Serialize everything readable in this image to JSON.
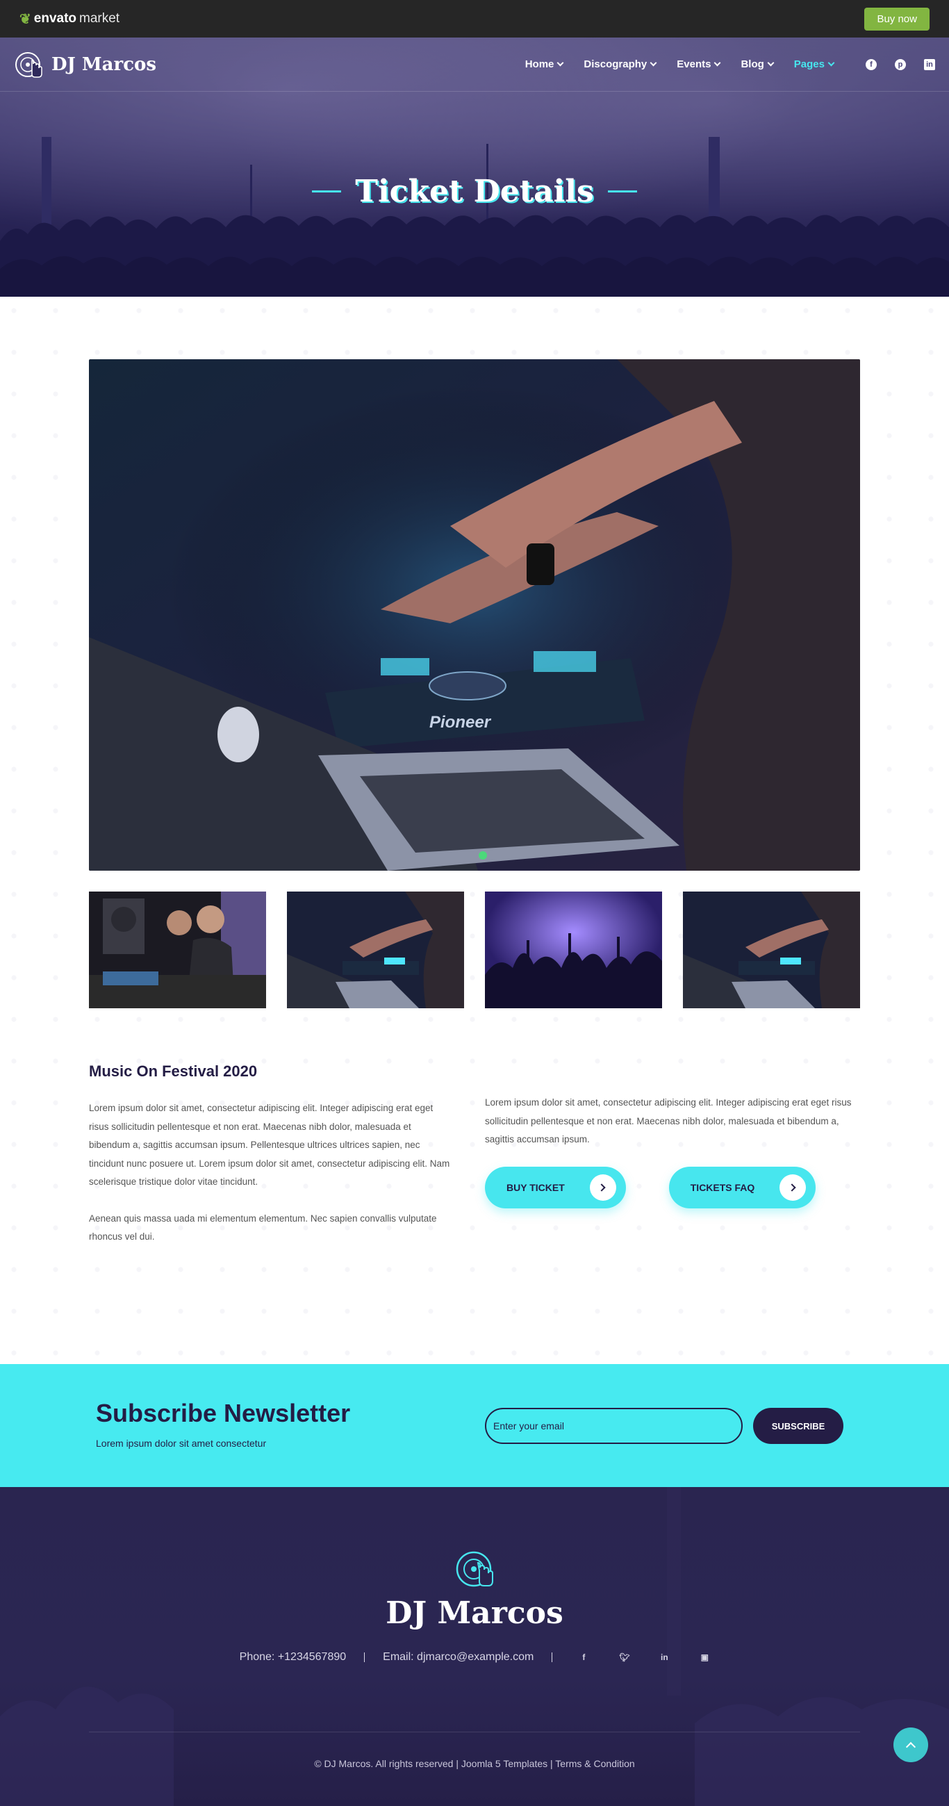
{
  "envato": {
    "logo_word": "envato",
    "logo_suffix": "market",
    "buy_label": "Buy now"
  },
  "header": {
    "brand": "DJ Marcos",
    "nav": [
      {
        "label": "Home"
      },
      {
        "label": "Discography"
      },
      {
        "label": "Events"
      },
      {
        "label": "Blog"
      },
      {
        "label": "Pages"
      }
    ],
    "social_icons": [
      "facebook-icon",
      "pinterest-icon",
      "linkedin-icon"
    ]
  },
  "hero": {
    "title": "Ticket Details"
  },
  "event": {
    "title": "Music On Festival 2020",
    "paragraph_1": "Lorem ipsum dolor sit amet, consectetur adipiscing elit. Integer adipiscing erat eget risus sollicitudin pellentesque et non erat. Maecenas nibh dolor, malesuada et bibendum a, sagittis accumsan ipsum. Pellentesque ultrices ultrices sapien, nec tincidunt nunc posuere ut. Lorem ipsum dolor sit amet, consectetur adipiscing elit. Nam scelerisque tristique dolor vitae tincidunt.",
    "paragraph_2": "Aenean quis massa uada mi elementum elementum. Nec sapien convallis vulputate rhoncus vel dui.",
    "paragraph_right": "Lorem ipsum dolor sit amet, consectetur adipiscing elit. Integer adipiscing erat eget risus sollicitudin pellentesque et non erat. Maecenas nibh dolor, malesuada et bibendum a, sagittis accumsan ipsum.",
    "buy_ticket_label": "BUY TICKET",
    "tickets_faq_label": "TICKETS FAQ"
  },
  "newsletter": {
    "title": "Subscribe Newsletter",
    "subtitle": "Lorem ipsum dolor sit amet consectetur",
    "placeholder": "Enter your email",
    "button_label": "SUBSCRIBE"
  },
  "footer": {
    "brand": "DJ Marcos",
    "phone": "Phone: +1234567890",
    "email": "Email: djmarco@example.com",
    "social_icons": [
      "facebook-icon",
      "twitter-icon",
      "linkedin-icon",
      "instagram-icon"
    ],
    "copyright": "© DJ Marcos. All rights reserved | Joomla 5 Templates | Terms & Condition"
  },
  "colors": {
    "accent": "#47e6ee",
    "dark": "#241d45",
    "envato_green": "#82b541",
    "footer_bg": "#2a2550"
  }
}
